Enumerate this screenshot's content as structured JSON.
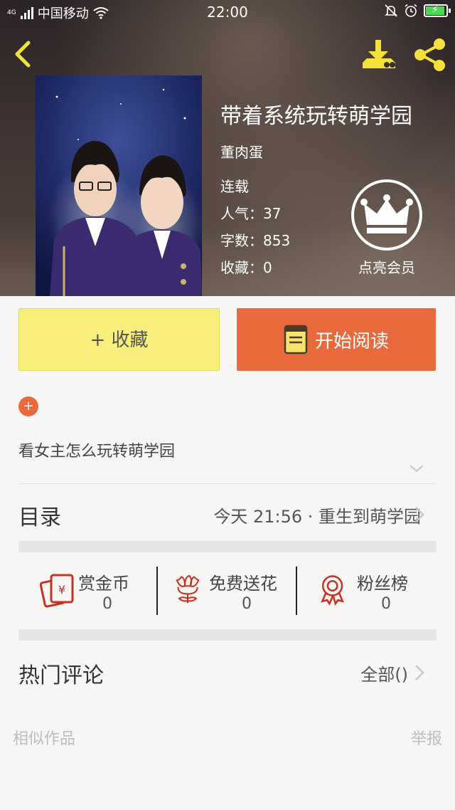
{
  "status_bar": {
    "network_tag": "4G",
    "carrier": "中国移动",
    "time": "22:00"
  },
  "header": {
    "back_icon": "back-arrow-icon",
    "download_icon": "download-icon",
    "share_icon": "share-icon"
  },
  "book": {
    "title": "带着系统玩转萌学园",
    "author": "董肉蛋",
    "status": "连载",
    "popularity": "人气：37",
    "word_count": "字数：853",
    "favorites": "收藏：0",
    "description": "看女主怎么玩转萌学园"
  },
  "vip": {
    "icon": "crown-icon",
    "label": "点亮会员"
  },
  "actions": {
    "favorite_label": "+ 收藏",
    "read_label": "开始阅读",
    "read_icon": "book-icon"
  },
  "toc": {
    "label": "目录",
    "latest": "今天 21:56 · 重生到萌学园"
  },
  "stats": [
    {
      "icon": "red-envelope-icon",
      "label": "赏金币",
      "value": "0"
    },
    {
      "icon": "flower-icon",
      "label": "免费送花",
      "value": "0"
    },
    {
      "icon": "award-ribbon-icon",
      "label": "粉丝榜",
      "value": "0"
    }
  ],
  "comments": {
    "label": "热门评论",
    "all_label": "全部()"
  },
  "footer": {
    "similar_label": "相似作品",
    "report_label": "举报"
  },
  "colors": {
    "accent_yellow": "#f4e23a",
    "favorite_button": "#f8f07a",
    "read_button": "#e96a3d",
    "stat_icon_red": "#c9301f"
  }
}
